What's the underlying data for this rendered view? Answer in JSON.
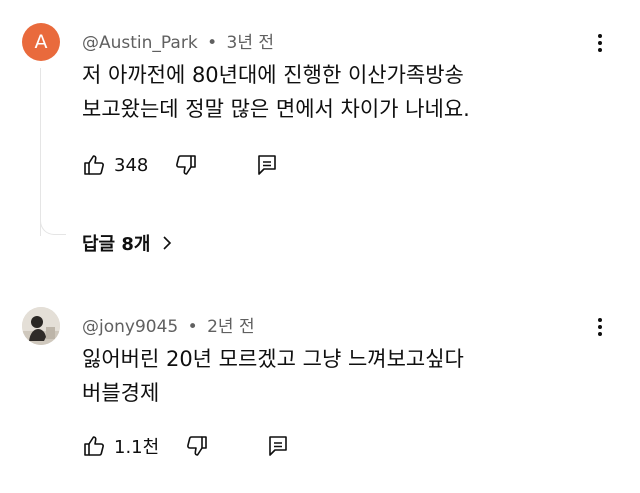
{
  "comments": [
    {
      "avatar_letter": "A",
      "author": "@Austin_Park",
      "separator": "•",
      "time": "3년 전",
      "lines": [
        "저 아까전에 80년대에 진행한 이산가족방송",
        "보고왔는데 정말 많은 면에서 차이가 나네요."
      ],
      "likes": "348",
      "replies_label": "답글 8개"
    },
    {
      "author": "@jony9045",
      "separator": "•",
      "time": "2년 전",
      "lines": [
        "잃어버린 20년 모르겠고 그냥 느껴보고싶다",
        "버블경제"
      ],
      "likes": "1.1천"
    }
  ],
  "icons": {
    "like": "thumbs-up-icon",
    "dislike": "thumbs-down-icon",
    "reply": "reply-icon",
    "more": "kebab-menu-icon",
    "replies_chevron": "chevron-right-icon"
  },
  "colors": {
    "avatar_a": "#e96a3c",
    "meta_text": "#606060",
    "thread_line": "#e5e5e5"
  }
}
